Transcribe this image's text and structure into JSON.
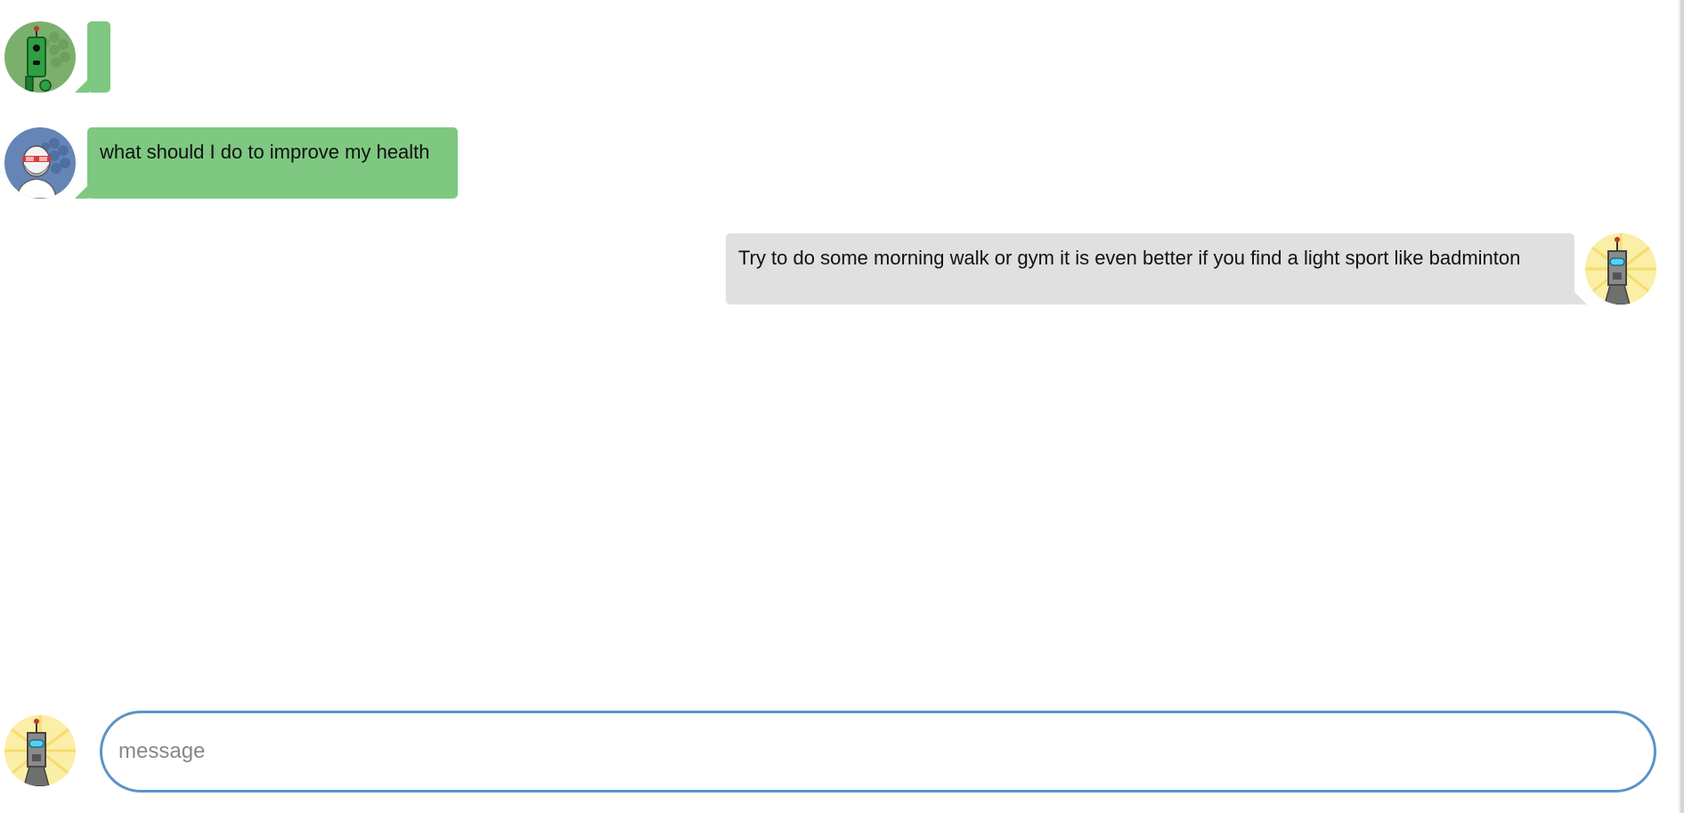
{
  "messages": [
    {
      "sender": "green-robot",
      "text": "",
      "side": "left",
      "avatar_icon": "green-robot-icon"
    },
    {
      "sender": "user",
      "text": "what should I do to improve my health",
      "side": "left",
      "avatar_icon": "bearded-man-goggles-icon"
    },
    {
      "sender": "bot",
      "text": "Try to do some morning walk or gym it is even better if you find a light sport like badminton",
      "side": "right",
      "avatar_icon": "grey-robot-icon"
    }
  ],
  "composer": {
    "placeholder": "message",
    "value": "",
    "avatar_icon": "grey-robot-icon"
  },
  "colors": {
    "left_bubble": "#7ec881",
    "right_bubble": "#e0e0e0",
    "input_border": "#5b93c9",
    "green_avatar_bg": "#7bb06c",
    "blue_avatar_bg": "#6485b6",
    "yellow_avatar_bg": "#fbeea6"
  }
}
